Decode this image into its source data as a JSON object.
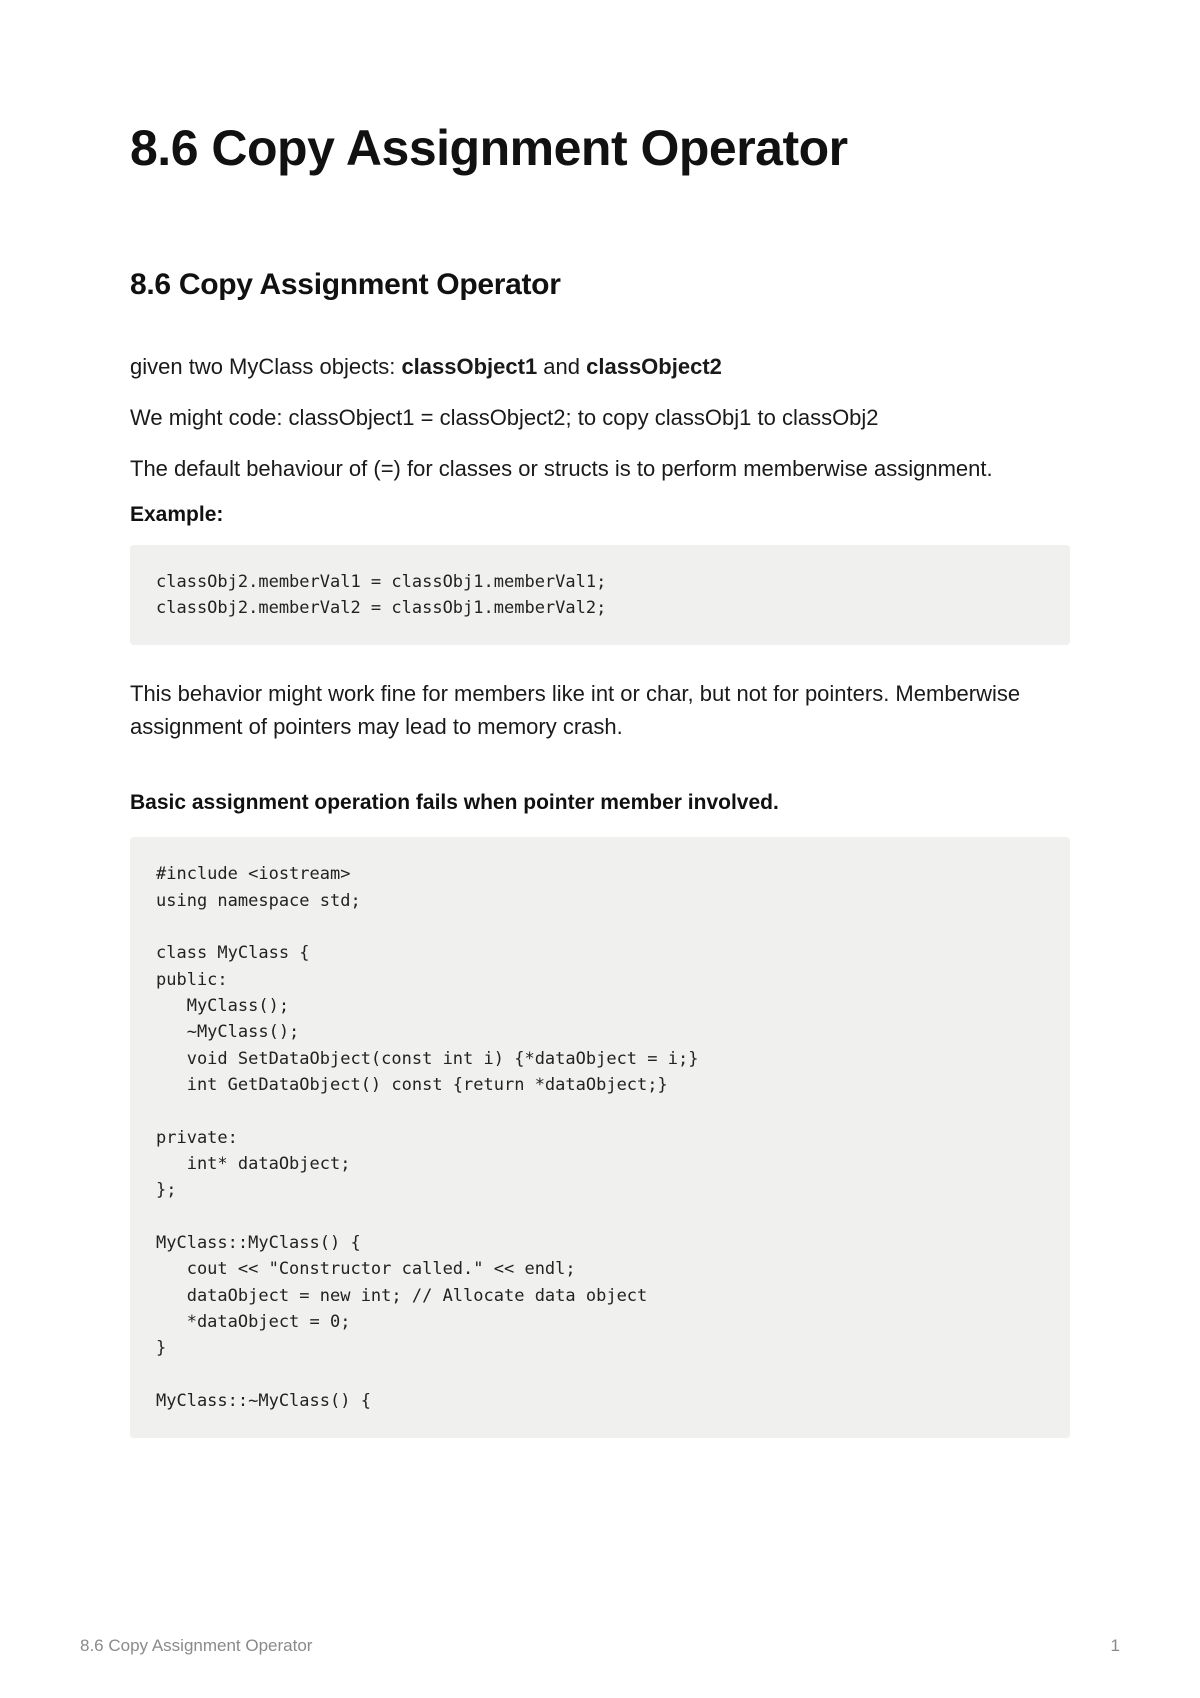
{
  "title": "8.6 Copy Assignment Operator",
  "subtitle": "8.6 Copy Assignment Operator",
  "intro": {
    "line1_prefix": "given two MyClass objects: ",
    "obj1": "classObject1",
    "and": " and ",
    "obj2": "classObject2",
    "line2": "We might code: classObject1 = classObject2; to copy classObj1 to classObj2",
    "line3": "The default behaviour of (=) for classes or structs is to perform memberwise assignment."
  },
  "example_label": "Example:",
  "code1": "classObj2.memberVal1 = classObj1.memberVal1;\nclassObj2.memberVal2 = classObj1.memberVal2;",
  "after_code": "This behavior might work fine for members like int or char, but not for pointers. Memberwise assignment of pointers may lead to memory crash.",
  "section2_label": "Basic assignment operation fails when pointer member involved.",
  "code2": "#include <iostream>\nusing namespace std;\n\nclass MyClass {\npublic:\n   MyClass();\n   ~MyClass();\n   void SetDataObject(const int i) {*dataObject = i;}\n   int GetDataObject() const {return *dataObject;}\n\nprivate:\n   int* dataObject;\n};\n\nMyClass::MyClass() {\n   cout << \"Constructor called.\" << endl;\n   dataObject = new int; // Allocate data object\n   *dataObject = 0;\n}\n\nMyClass::~MyClass() {",
  "footer": {
    "left": "8.6 Copy Assignment Operator",
    "right": "1"
  }
}
